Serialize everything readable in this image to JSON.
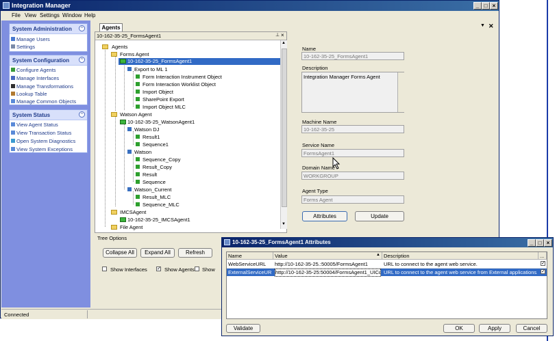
{
  "window": {
    "title": "Integration Manager"
  },
  "menu": [
    "File",
    "View",
    "Settings",
    "Window",
    "Help"
  ],
  "sidebar": {
    "admin": {
      "title": "System Administration",
      "items": [
        "Manage Users",
        "Settings"
      ]
    },
    "config": {
      "title": "System Configuration",
      "items": [
        "Configure Agents",
        "Manage Interfaces",
        "Manage Transformations",
        "Lookup Table",
        "Manage Common Objects"
      ]
    },
    "status": {
      "title": "System Status",
      "items": [
        "View Agent Status",
        "View Transaction Status",
        "Open System Diagnostics",
        "View System Exceptions"
      ]
    }
  },
  "tabs": {
    "agents": "Agents",
    "close": "✕"
  },
  "tree": {
    "header": "10-162-35-25_FormsAgent1",
    "nodes": [
      "Agents",
      "Forms Agent",
      "10-162-35-25_FormsAgent1",
      "Export to ML 1",
      "Form Interaction Instrument Object",
      "Form Interaction Worklist Object",
      "Import Object",
      "SharePoint Export",
      "Import Object MLC",
      "Watson Agent",
      "10-162-35-25_WatsonAgent1",
      "Watson DJ",
      "Result1",
      "Sequence1",
      "Watson",
      "Sequence_Copy",
      "Result_Copy",
      "Result",
      "Sequence",
      "Watson_Current",
      "Result_MLC",
      "Sequence_MLC",
      "IMCSAgent",
      "10-162-35-25_IMCSAgent1",
      "File Agent"
    ]
  },
  "tree_options": {
    "title": "Tree Options",
    "collapse_all": "Collapse All",
    "expand_all": "Expand All",
    "refresh": "Refresh",
    "show_interfaces": "Show Interfaces",
    "show_agents": "Show Agents",
    "show_more": "Show"
  },
  "details": {
    "name_label": "Name",
    "name_value": "10-162-35-25_FormsAgent1",
    "desc_label": "Description",
    "desc_value": "Integration Manager Forms Agent",
    "machine_label": "Machine Name",
    "machine_value": "10-162-35-25",
    "service_label": "Service Name",
    "service_value": "FormsAgent1",
    "domain_label": "Domain Name",
    "domain_value": "WORKGROUP",
    "type_label": "Agent Type",
    "type_value": "Forms Agent",
    "attributes_button": "Attributes",
    "update_button": "Update"
  },
  "status_bar": {
    "text": "Connected"
  },
  "dialog": {
    "title": "10-162-35-25_FormsAgent1 Attributes",
    "columns": [
      "Name",
      "Value",
      "Description",
      "..."
    ],
    "rows": [
      {
        "name": "WebServiceURL",
        "value": "http://10-162-35-25.:50005/FormsAgent1",
        "description": "URL to connect to the agent web service."
      },
      {
        "name": "ExternalServiceURL",
        "value": "http://10-162-35-25:50004/FormsAgent1_UIComm",
        "description": "URL to connect to the agent web service from External applications."
      }
    ],
    "validate": "Validate",
    "ok": "OK",
    "apply": "Apply",
    "cancel": "Cancel"
  }
}
